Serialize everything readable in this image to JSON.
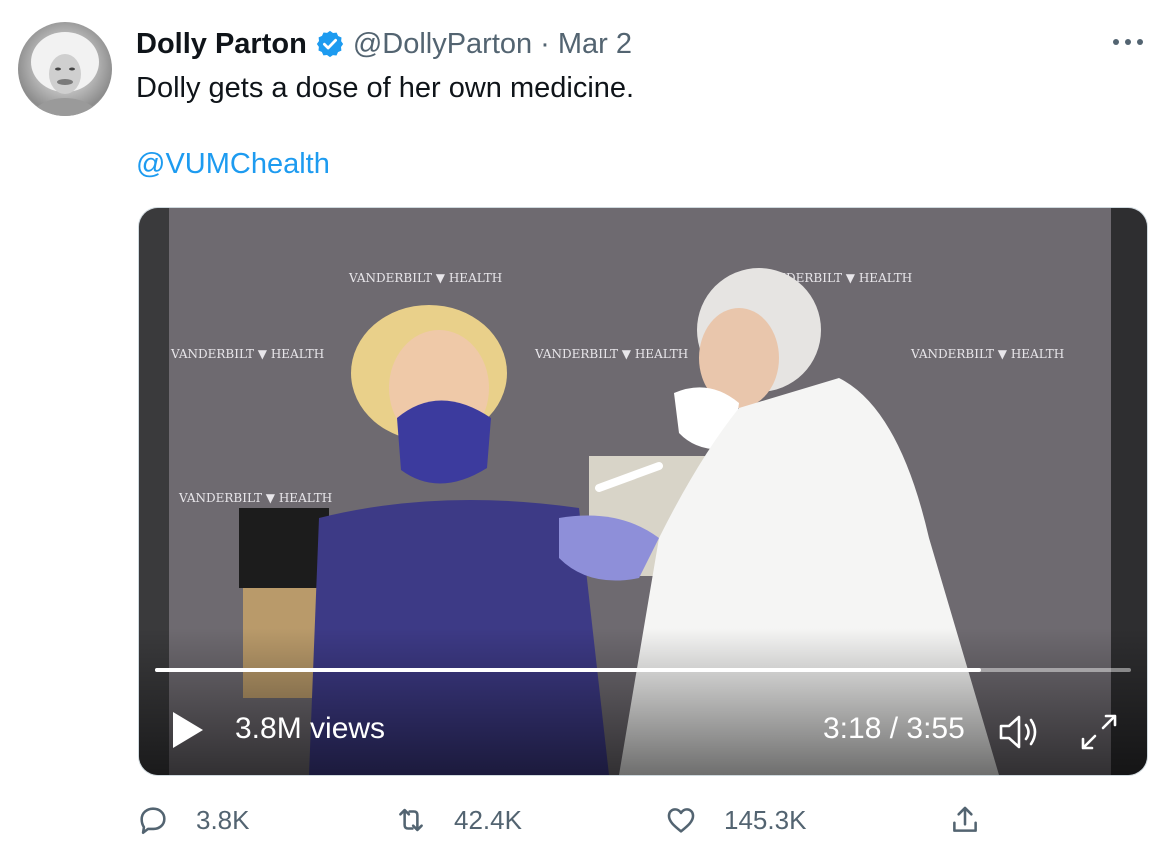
{
  "tweet": {
    "author_name": "Dolly Parton",
    "handle": "@DollyParton",
    "separator": "·",
    "date": "Mar 2",
    "text": "Dolly gets a dose of her own medicine.",
    "mention": "@VUMChealth"
  },
  "video": {
    "views": "3.8M views",
    "time": "3:18 / 3:55",
    "progress": 0.846,
    "backdrop_text": "VANDERBILT ▼ HEALTH"
  },
  "actions": {
    "reply_count": "3.8K",
    "retweet_count": "42.4K",
    "like_count": "145.3K"
  },
  "colors": {
    "accent": "#1d9bf0",
    "secondary_text": "#536471"
  },
  "icons": [
    "verified-badge-icon",
    "more-options-icon",
    "play-icon",
    "volume-icon",
    "fullscreen-icon",
    "reply-icon",
    "retweet-icon",
    "like-icon",
    "share-icon"
  ]
}
